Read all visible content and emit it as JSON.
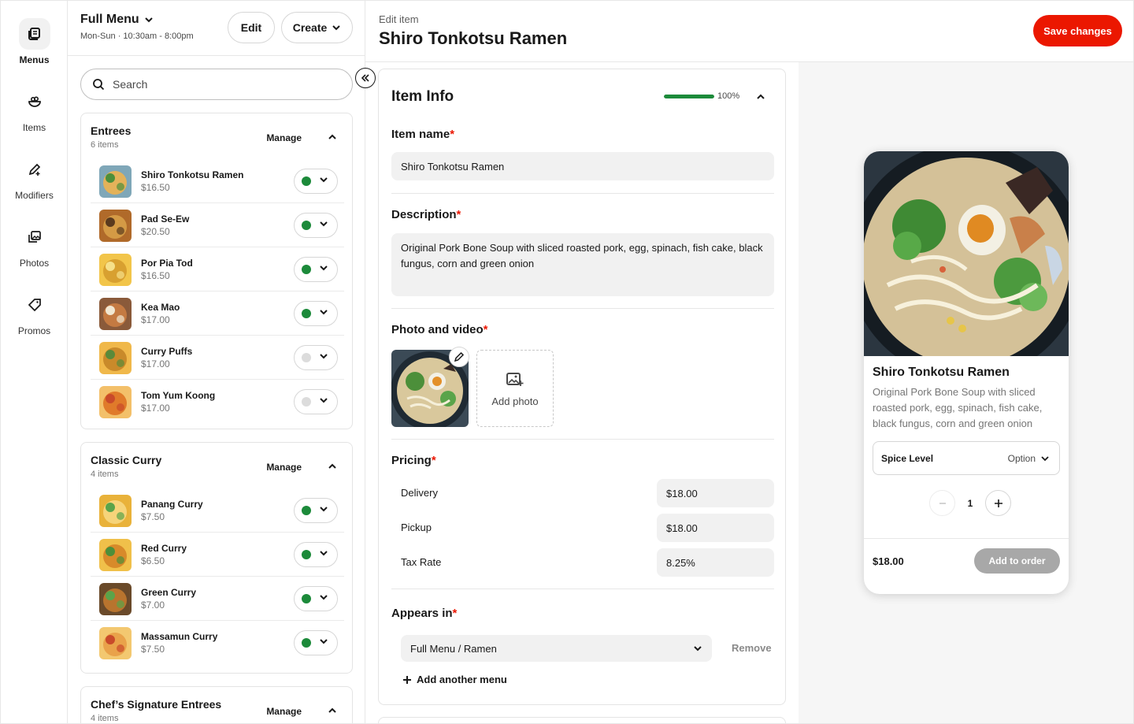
{
  "nav": [
    {
      "label": "Menus",
      "icon": "menus-icon",
      "active": true
    },
    {
      "label": "Items",
      "icon": "items-icon",
      "active": false
    },
    {
      "label": "Modifiers",
      "icon": "modifiers-icon",
      "active": false
    },
    {
      "label": "Photos",
      "icon": "photos-icon",
      "active": false
    },
    {
      "label": "Promos",
      "icon": "promos-icon",
      "active": false
    }
  ],
  "menu": {
    "name": "Full Menu",
    "hours": "Mon-Sun · 10:30am - 8:00pm",
    "edit_label": "Edit",
    "create_label": "Create",
    "search_placeholder": "Search",
    "categories": [
      {
        "name": "Entrees",
        "count": "6 items",
        "manage": "Manage",
        "items": [
          {
            "name": "Shiro Tonkotsu Ramen",
            "price": "$16.50",
            "active": true
          },
          {
            "name": "Pad Se-Ew",
            "price": "$20.50",
            "active": true
          },
          {
            "name": "Por Pia Tod",
            "price": "$16.50",
            "active": true
          },
          {
            "name": "Kea Mao",
            "price": "$17.00",
            "active": true
          },
          {
            "name": "Curry Puffs",
            "price": "$17.00",
            "active": false
          },
          {
            "name": "Tom Yum Koong",
            "price": "$17.00",
            "active": false
          }
        ]
      },
      {
        "name": "Classic Curry",
        "count": "4 items",
        "manage": "Manage",
        "items": [
          {
            "name": "Panang Curry",
            "price": "$7.50",
            "active": true
          },
          {
            "name": "Red Curry",
            "price": "$6.50",
            "active": true
          },
          {
            "name": "Green Curry",
            "price": "$7.00",
            "active": true
          },
          {
            "name": "Massamun Curry",
            "price": "$7.50",
            "active": true
          }
        ]
      },
      {
        "name": "Chef’s Signature Entrees",
        "count": "4 items",
        "manage": "Manage",
        "items": []
      }
    ]
  },
  "header": {
    "kicker": "Edit item",
    "title": "Shiro Tonkotsu Ramen",
    "save_label": "Save changes"
  },
  "item_info": {
    "title": "Item Info",
    "progress_pct": 100,
    "progress_label": "100%",
    "name_label": "Item name",
    "name_value": "Shiro Tonkotsu Ramen",
    "description_label": "Description",
    "description_value": "Original Pork Bone Soup with sliced roasted pork, egg, spinach, fish cake, black fungus, corn and green onion",
    "photo_label": "Photo and video",
    "add_photo_label": "Add photo",
    "pricing_label": "Pricing",
    "pricing": [
      {
        "label": "Delivery",
        "value": "$18.00"
      },
      {
        "label": "Pickup",
        "value": "$18.00"
      },
      {
        "label": "Tax Rate",
        "value": "8.25%"
      }
    ],
    "appears_label": "Appears in",
    "appears_value": "Full Menu / Ramen",
    "remove_label": "Remove",
    "add_menu_label": "Add another menu",
    "required_mark": "*"
  },
  "preview": {
    "title": "Shiro Tonkotsu Ramen",
    "description": "Original Pork Bone Soup with sliced roasted pork, egg, spinach, fish cake, black fungus, corn and green onion",
    "spice_label": "Spice Level",
    "spice_option": "Option",
    "quantity": "1",
    "price": "$18.00",
    "add_label": "Add to order"
  },
  "colors": {
    "accent": "#eb1700",
    "active_dot": "#1c8a3a",
    "inactive_dot": "#dcdcdc"
  }
}
